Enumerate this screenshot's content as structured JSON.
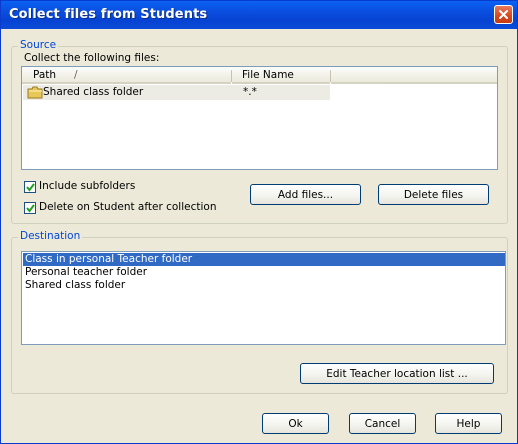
{
  "window": {
    "title": "Collect files from Students"
  },
  "source": {
    "legend": "Source",
    "collect_label": "Collect the following files:",
    "columns": {
      "path": "Path",
      "sort_indicator": "/",
      "file_name": "File Name"
    },
    "rows": [
      {
        "path": "Shared class folder",
        "file_name": "*.*"
      }
    ],
    "include_subfolders": {
      "label": "Include subfolders",
      "checked": true
    },
    "delete_after": {
      "label": "Delete on Student after collection",
      "checked": true
    },
    "add_files_label": "Add files...",
    "delete_files_label": "Delete files"
  },
  "destination": {
    "legend": "Destination",
    "items": [
      "Class in personal Teacher folder",
      "Personal teacher folder",
      "Shared class folder"
    ],
    "selected_index": 0,
    "edit_label": "Edit Teacher location list ..."
  },
  "footer": {
    "ok_label": "Ok",
    "cancel_label": "Cancel",
    "help_label": "Help"
  },
  "colors": {
    "title_bar": "#0b4fe0",
    "selection": "#316ac5",
    "legend_text": "#0046d5"
  }
}
